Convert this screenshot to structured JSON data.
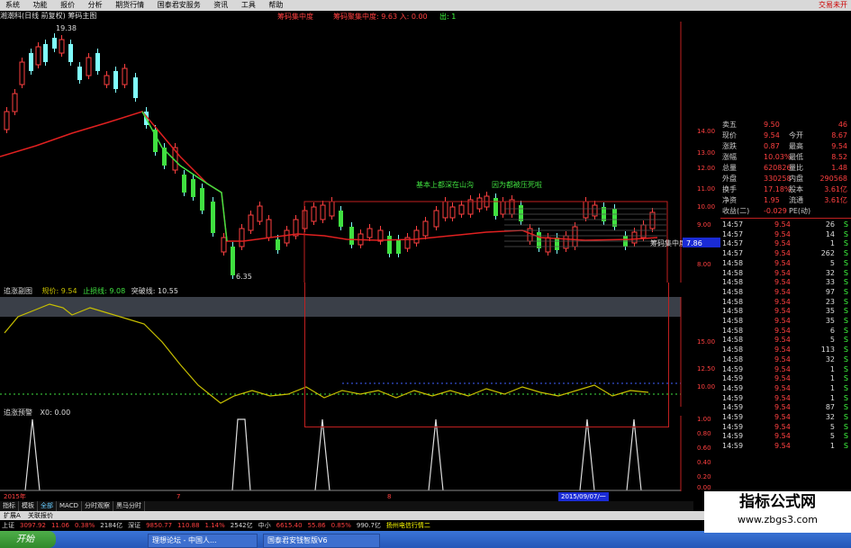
{
  "menu": {
    "items": [
      "系统",
      "功能",
      "报价",
      "分析",
      "期货行情",
      "国泰君安服务",
      "资讯",
      "工具",
      "帮助"
    ],
    "trade": "交易未开"
  },
  "title": {
    "stock": "湘潮科(日线 前复权)",
    "indicator": "筹码主图",
    "chip_label": "筹码集中度",
    "chip_text": "筹码聚集中度: 9.63 入: 0.00",
    "chip_extra": "出: 1"
  },
  "main_chart": {
    "high_label": "19.38",
    "low_label": "6.35",
    "annotation_1": "基本上都深在山沟",
    "annotation_2": "因为都被压死啦",
    "chip_box_label": "筹码集中度",
    "chip_box_value": "7.86",
    "y_ticks": [
      "14.00",
      "13.00",
      "12.00",
      "11.00",
      "10.00",
      "9.00",
      "8.00"
    ]
  },
  "sub1": {
    "name": "追涨副图",
    "trend_label": "规价:",
    "trend_value": "9.54",
    "stop_label": "止损线:",
    "stop_value": "9.08",
    "break_label": "突破线:",
    "break_value": "10.55",
    "y_ticks": [
      "15.00",
      "12.50",
      "10.00"
    ]
  },
  "sub2": {
    "name": "追涨预警",
    "x_label": "X0:",
    "x_value": "0.00",
    "y_ticks": [
      "1.00",
      "0.80",
      "0.60",
      "0.40",
      "0.20",
      "0.00"
    ]
  },
  "date_axis": {
    "year": "2015年",
    "month_7": "7",
    "month_8": "8",
    "cursor_date": "2015/09/07/一"
  },
  "quote": {
    "rows": [
      {
        "k": "卖五",
        "v": "9.50",
        "k2": "",
        "v2": "46"
      },
      {
        "k": "现价",
        "v": "9.54",
        "k2": "今开",
        "v2": "8.67"
      },
      {
        "k": "涨跌",
        "v": "0.87",
        "k2": "最高",
        "v2": "9.54"
      },
      {
        "k": "涨幅",
        "v": "10.03%",
        "k2": "最低",
        "v2": "8.52"
      },
      {
        "k": "总量",
        "v": "620826",
        "k2": "量比",
        "v2": "1.48"
      },
      {
        "k": "外盘",
        "v": "330258",
        "k2": "内盘",
        "v2": "290568"
      },
      {
        "k": "换手",
        "v": "17.18%",
        "k2": "股本",
        "v2": "3.61亿"
      },
      {
        "k": "净资",
        "v": "1.95",
        "k2": "流通",
        "v2": "3.61亿"
      },
      {
        "k": "收益(二)",
        "v": "-0.029",
        "k2": "PE(动)",
        "v2": ""
      }
    ],
    "ticks": [
      {
        "t": "14:57",
        "p": "9.54",
        "vol": "26",
        "bs": "S"
      },
      {
        "t": "14:57",
        "p": "9.54",
        "vol": "14",
        "bs": "S"
      },
      {
        "t": "14:57",
        "p": "9.54",
        "vol": "1",
        "bs": "S"
      },
      {
        "t": "14:57",
        "p": "9.54",
        "vol": "262",
        "bs": "S"
      },
      {
        "t": "14:58",
        "p": "9.54",
        "vol": "5",
        "bs": "S"
      },
      {
        "t": "14:58",
        "p": "9.54",
        "vol": "32",
        "bs": "S"
      },
      {
        "t": "14:58",
        "p": "9.54",
        "vol": "33",
        "bs": "S"
      },
      {
        "t": "14:58",
        "p": "9.54",
        "vol": "97",
        "bs": "S"
      },
      {
        "t": "14:58",
        "p": "9.54",
        "vol": "23",
        "bs": "S"
      },
      {
        "t": "14:58",
        "p": "9.54",
        "vol": "35",
        "bs": "S"
      },
      {
        "t": "14:58",
        "p": "9.54",
        "vol": "35",
        "bs": "S"
      },
      {
        "t": "14:58",
        "p": "9.54",
        "vol": "6",
        "bs": "S"
      },
      {
        "t": "14:58",
        "p": "9.54",
        "vol": "5",
        "bs": "S"
      },
      {
        "t": "14:58",
        "p": "9.54",
        "vol": "113",
        "bs": "S"
      },
      {
        "t": "14:58",
        "p": "9.54",
        "vol": "32",
        "bs": "S"
      },
      {
        "t": "14:59",
        "p": "9.54",
        "vol": "1",
        "bs": "S"
      },
      {
        "t": "14:59",
        "p": "9.54",
        "vol": "1",
        "bs": "S"
      },
      {
        "t": "14:59",
        "p": "9.54",
        "vol": "1",
        "bs": "S"
      },
      {
        "t": "14:59",
        "p": "9.54",
        "vol": "1",
        "bs": "S"
      },
      {
        "t": "14:59",
        "p": "9.54",
        "vol": "87",
        "bs": "S"
      },
      {
        "t": "14:59",
        "p": "9.54",
        "vol": "32",
        "bs": "S"
      },
      {
        "t": "14:59",
        "p": "9.54",
        "vol": "5",
        "bs": "S"
      },
      {
        "t": "14:59",
        "p": "9.54",
        "vol": "5",
        "bs": "S"
      },
      {
        "t": "14:59",
        "p": "9.54",
        "vol": "1",
        "bs": "S"
      }
    ]
  },
  "tabs": [
    "指标",
    "模板",
    "全部",
    "MACD",
    "分时观察",
    "黑马分时"
  ],
  "ext_bar": [
    "扩展A",
    "关联报价"
  ],
  "index_bar": {
    "sh_label": "上证",
    "sh_value": "3097.92",
    "sh_chg": "11.06",
    "sh_pct": "0.38%",
    "sh_amt": "2184亿",
    "sz_label": "深证",
    "sz_value": "9850.77",
    "sz_chg": "110.88",
    "sz_pct": "1.14%",
    "sz_amt": "2542亿",
    "mid_label": "中小",
    "mid_value": "6615.40",
    "mid_chg": "55.86",
    "mid_pct": "0.85%",
    "mid_amt": "990.7亿",
    "news": "扬州电信行情二"
  },
  "taskbar": {
    "start": "开始",
    "tasks": [
      "理想论坛 - 中国人...",
      "国泰君安钱智版V6"
    ]
  },
  "watermark": {
    "line1": "指标公式网",
    "line2": "www.zbgs3.com"
  },
  "colors": {
    "up": "#ff4040",
    "down": "#40ff40",
    "ma": "#e02020",
    "ma_green": "#40e040",
    "sub_line": "#c8c000",
    "axis": "#ff4040"
  }
}
